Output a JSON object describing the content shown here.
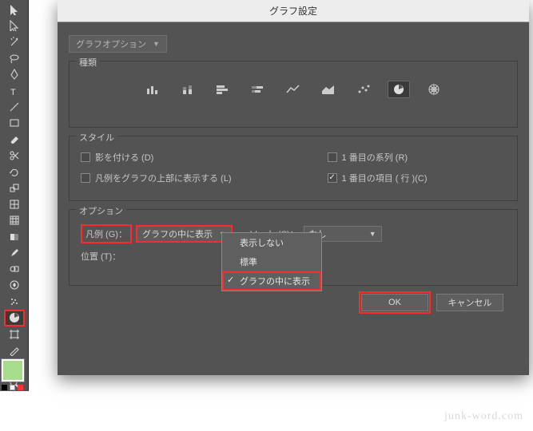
{
  "title": "グラフ設定",
  "mainSelect": {
    "label": "グラフオプション"
  },
  "sections": {
    "type": {
      "legend": "種類"
    },
    "style": {
      "legend": "スタイル",
      "shadow": {
        "label": "影を付ける (D)",
        "checked": false
      },
      "legendTop": {
        "label": "凡例をグラフの上部に表示する (L)",
        "checked": false
      },
      "firstSeries": {
        "label": "1 番目の系列 (R)",
        "checked": false
      },
      "firstItem": {
        "label": "1 番目の項目 ( 行 )(C)",
        "checked": true
      }
    },
    "options": {
      "legend": "オプション",
      "legendLabel": "凡例 (G)：",
      "legendSelect": {
        "selected": "グラフの中に表示",
        "items": [
          "表示しない",
          "標準",
          "グラフの中に表示"
        ],
        "checkedIndex": 2
      },
      "sortLabel": "ソート (S)：",
      "sortSelect": {
        "selected": "なし"
      },
      "positionLabel": "位置 (T)："
    }
  },
  "buttons": {
    "ok": "OK",
    "cancel": "キャンセル"
  },
  "watermark": "junk-word.com",
  "toolIcons": [
    "selection",
    "direct",
    "wand",
    "lasso",
    "pen",
    "type",
    "line",
    "rect",
    "brush",
    "scissors",
    "rotate",
    "scale",
    "warp",
    "mesh",
    "gradient",
    "eyedrop",
    "blend",
    "symbol",
    "spray",
    "graph",
    "artboard",
    "slice",
    "hand",
    "zoom"
  ],
  "chartTypes": [
    "column",
    "stacked-column",
    "bar",
    "stacked-bar",
    "line",
    "area",
    "scatter",
    "pie",
    "radar"
  ]
}
